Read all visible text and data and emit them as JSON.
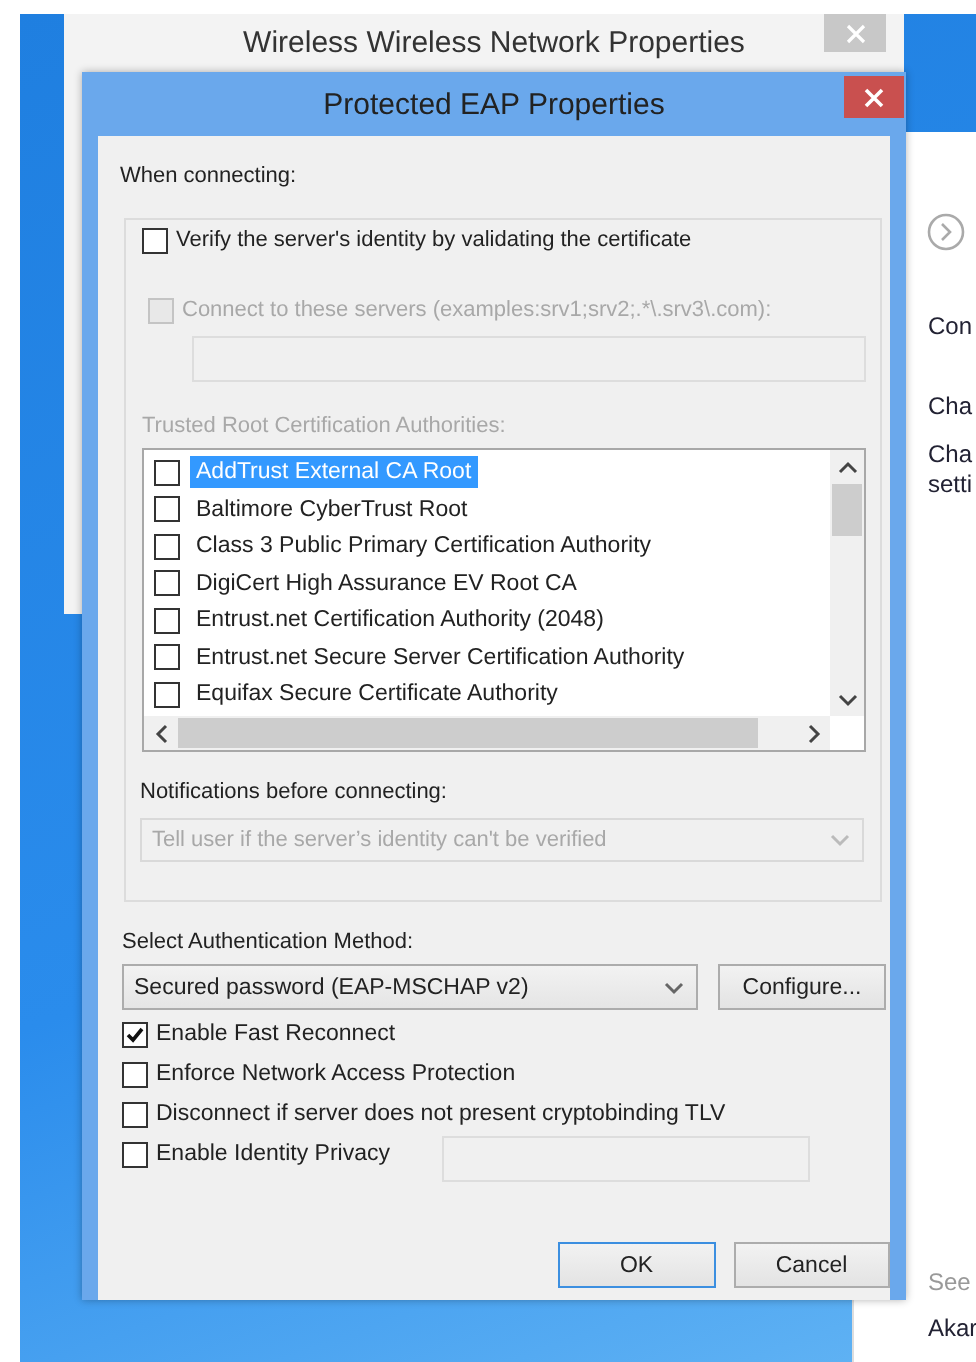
{
  "background_window": {
    "title": "Wireless Wireless Network Properties"
  },
  "side_panel": {
    "items": [
      {
        "text": "Con",
        "kind": "text"
      },
      {
        "text": "Cha",
        "kind": "text"
      },
      {
        "text": "Cha",
        "kind": "text"
      },
      {
        "text": "setti",
        "kind": "text"
      },
      {
        "text": "See",
        "kind": "muted"
      },
      {
        "text": "Akar",
        "kind": "text"
      }
    ]
  },
  "dialog": {
    "title": "Protected EAP Properties",
    "when_connecting": "When connecting:",
    "verify": {
      "label": "Verify the server's identity by validating the certificate",
      "checked": false,
      "disabled": false
    },
    "connect_servers": {
      "label": "Connect to these servers (examples:srv1;srv2;.*\\.srv3\\.com):",
      "checked": false,
      "disabled": true
    },
    "trusted_label": "Trusted Root Certification Authorities:",
    "ca_list": [
      {
        "label": "AddTrust External CA Root",
        "checked": false,
        "selected": true
      },
      {
        "label": "Baltimore CyberTrust Root",
        "checked": false,
        "selected": false
      },
      {
        "label": "Class 3 Public Primary Certification Authority",
        "checked": false,
        "selected": false
      },
      {
        "label": "DigiCert High Assurance EV Root CA",
        "checked": false,
        "selected": false
      },
      {
        "label": "Entrust.net Certification Authority (2048)",
        "checked": false,
        "selected": false
      },
      {
        "label": "Entrust.net Secure Server Certification Authority",
        "checked": false,
        "selected": false
      },
      {
        "label": "Equifax Secure Certificate Authority",
        "checked": false,
        "selected": false
      }
    ],
    "notifications_label": "Notifications before connecting:",
    "notifications_select": {
      "value": "Tell user if the server’s identity can't be verified",
      "disabled": true
    },
    "auth_label": "Select Authentication Method:",
    "auth_select": {
      "value": "Secured password (EAP-MSCHAP v2)",
      "disabled": false
    },
    "configure_button": "Configure...",
    "options": [
      {
        "label": "Enable Fast Reconnect",
        "checked": true,
        "disabled": false
      },
      {
        "label": "Enforce Network Access Protection",
        "checked": false,
        "disabled": false
      },
      {
        "label": "Disconnect if server does not present cryptobinding TLV",
        "checked": false,
        "disabled": false
      },
      {
        "label": "Enable Identity Privacy",
        "checked": false,
        "disabled": false
      }
    ],
    "buttons": [
      {
        "label": "OK",
        "default": true
      },
      {
        "label": "Cancel",
        "default": false
      }
    ]
  }
}
